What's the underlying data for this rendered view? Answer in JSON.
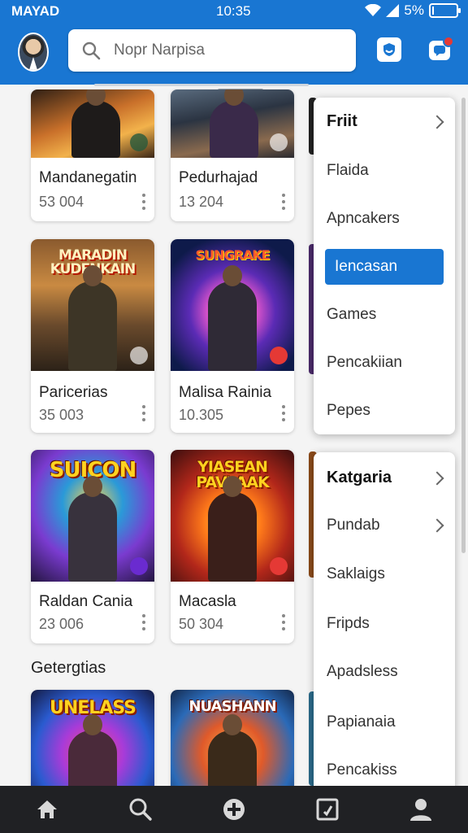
{
  "status_bar": {
    "carrier": "MAYAD",
    "time": "10:35",
    "battery": "5%"
  },
  "search": {
    "placeholder": "Nopr Narpisa"
  },
  "games": [
    {
      "title": "Mandanegatin",
      "count": "53 004",
      "art_text": "",
      "badge": ""
    },
    {
      "title": "Pedurhajad",
      "count": "13 204",
      "art_text": "",
      "badge": ""
    },
    {
      "title": "Paricerias",
      "count": "35 003",
      "art_text": "MARADIN KUDENKAIN",
      "badge": ""
    },
    {
      "title": "Malisa Rainia",
      "count": "10.305",
      "art_text": "SUNGRAKE",
      "badge": ""
    },
    {
      "title": "Raldan Cania",
      "count": "23 006",
      "art_text": "SUICON",
      "badge": ""
    },
    {
      "title": "Macasla",
      "count": "50 304",
      "art_text": "YIASEAN PAVLAAK",
      "badge": ""
    }
  ],
  "section": {
    "title": "Getergtias"
  },
  "bottom_games": [
    {
      "art_text": "UNELASS"
    },
    {
      "art_text": "NUASHANN"
    }
  ],
  "menu_top": {
    "header": "Friit",
    "items": [
      "Flaida",
      "Apncakers",
      "Iencasan",
      "Games",
      "Pencakiian",
      "Pepes"
    ],
    "selected_index": 2
  },
  "menu_bottom": {
    "header": "Katgaria",
    "items": [
      "Pundab",
      "Saklaigs",
      "Fripds",
      "Apadsless",
      "Papianaia",
      "Pencakiss"
    ]
  },
  "colors": {
    "primary": "#1976d2",
    "nav_bg": "#202124",
    "accent_red": "#e53935"
  },
  "icons": {
    "header_right": [
      "shield-icon",
      "notification-icon"
    ],
    "bottom_nav": [
      "home-icon",
      "search-icon",
      "add-icon",
      "library-icon",
      "profile-icon"
    ]
  }
}
